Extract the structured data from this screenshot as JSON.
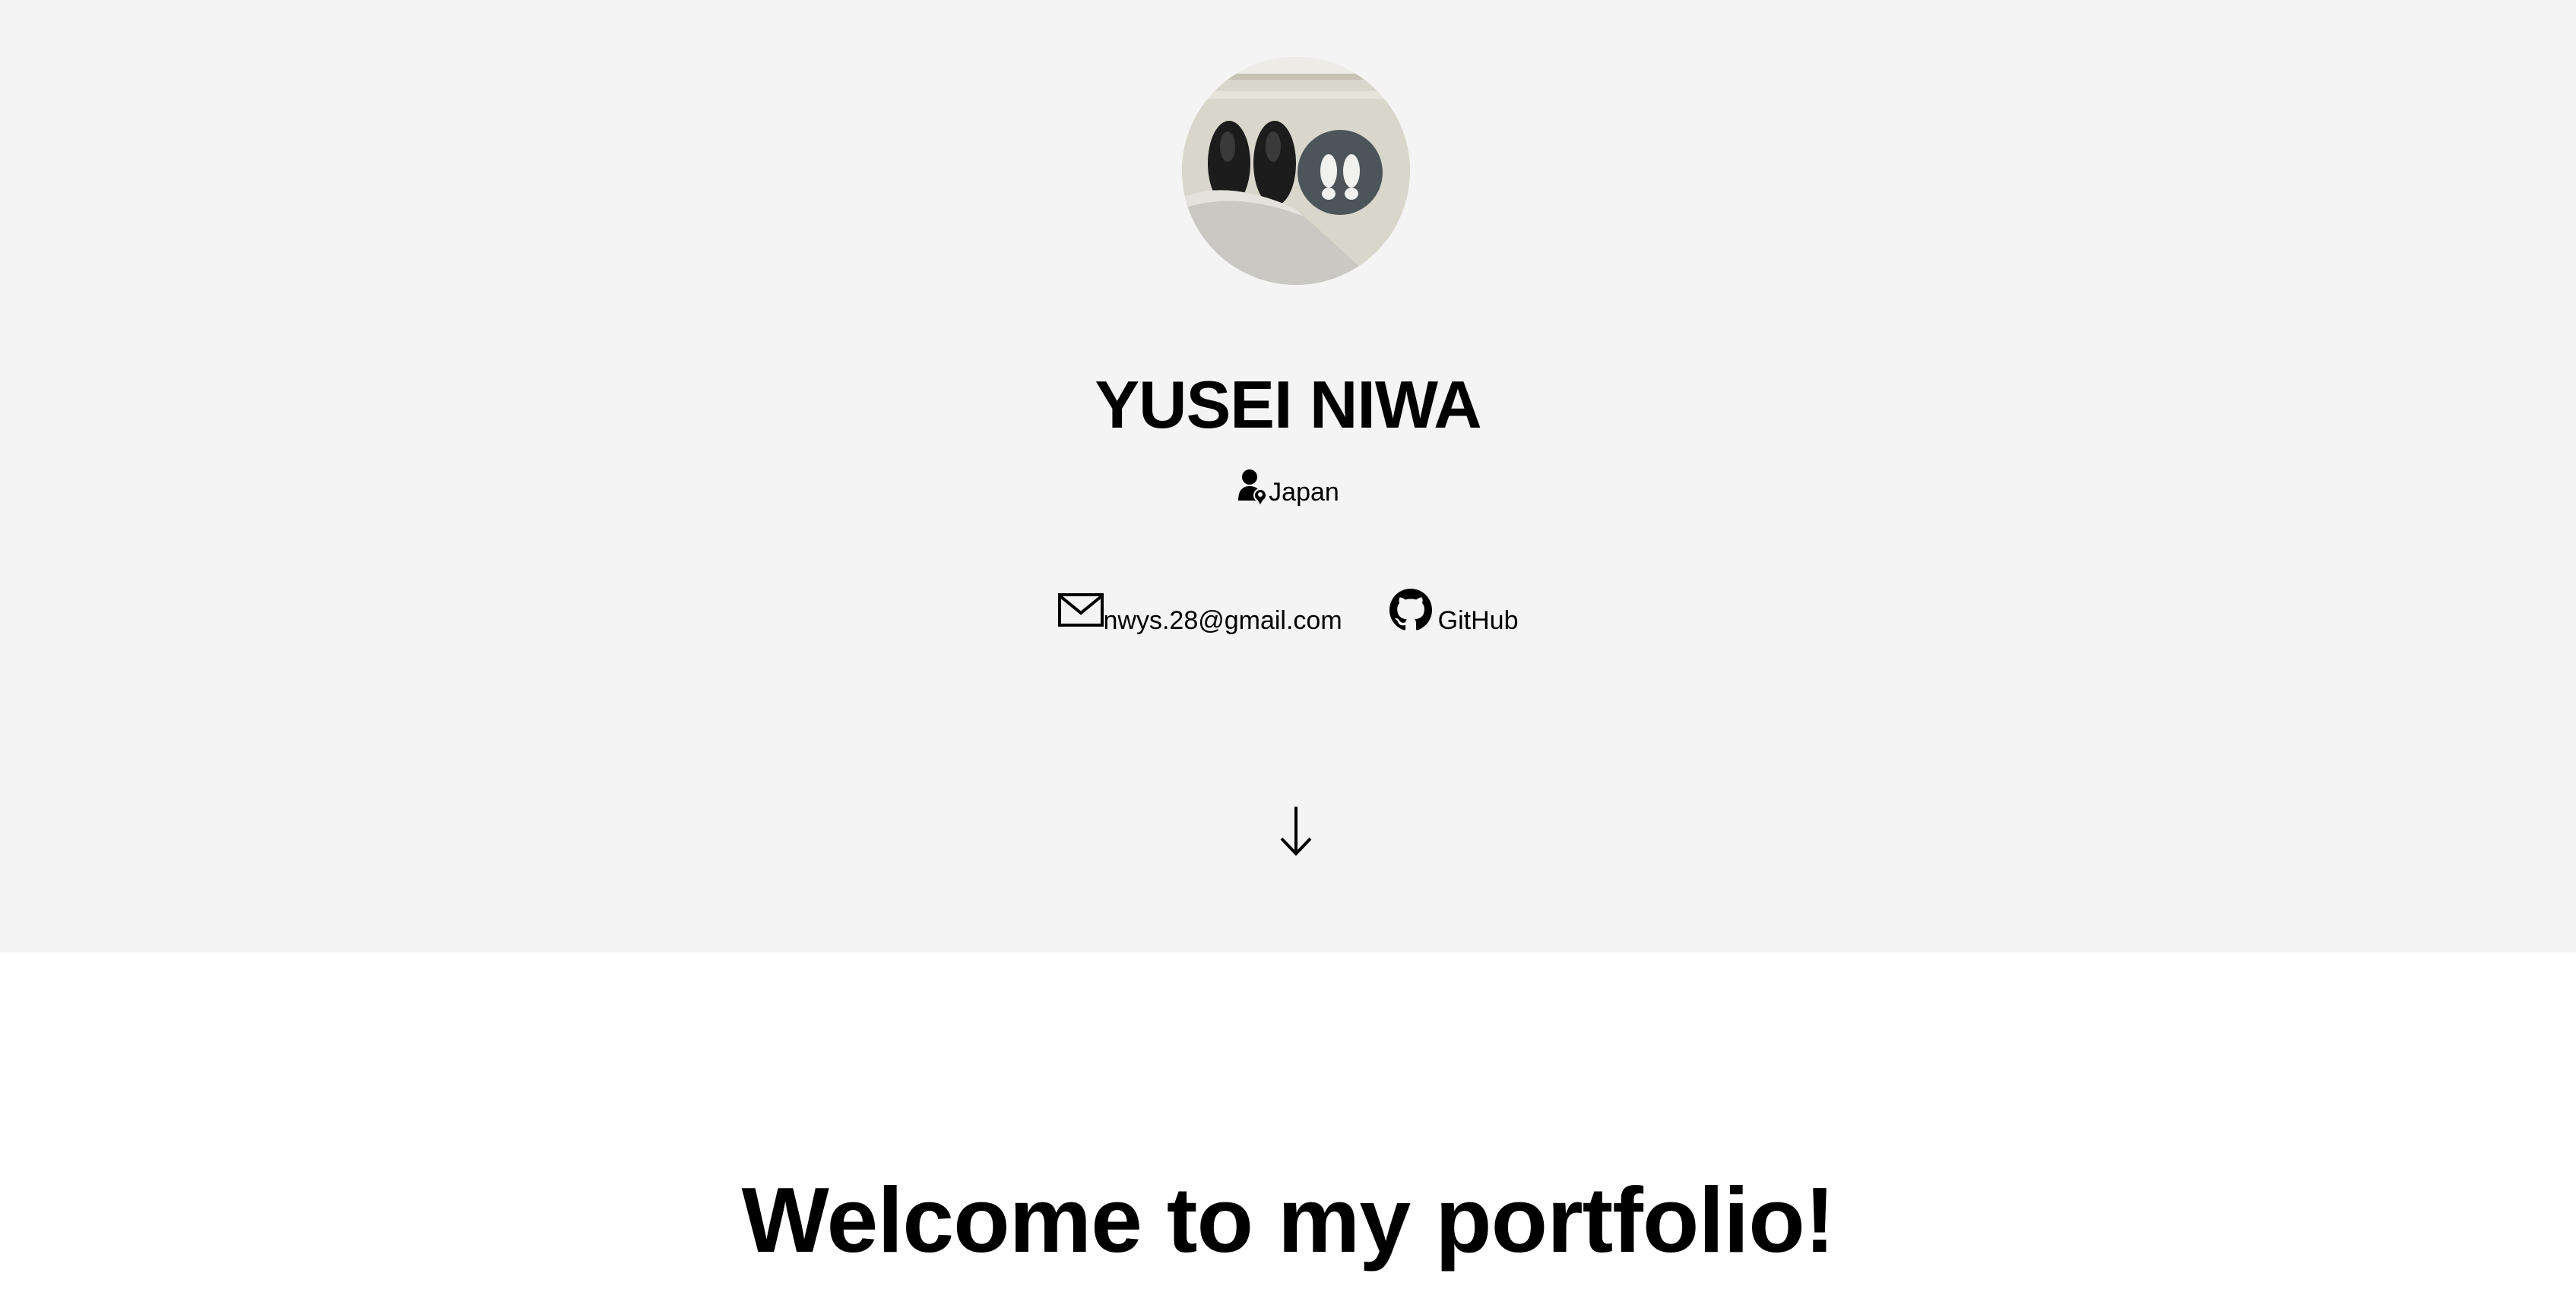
{
  "profile": {
    "name": "YUSEI NIWA",
    "location": "Japan",
    "avatar_icon": "shoes-photo"
  },
  "contacts": {
    "email_label": "nwys.28@gmail.com",
    "email_icon": "envelope-icon",
    "github_label": "GitHub",
    "github_icon": "github-icon"
  },
  "scroll": {
    "icon": "arrow-down-icon"
  },
  "intro": {
    "heading": "Welcome to my portfolio!"
  },
  "colors": {
    "hero_background": "#f4f4f4",
    "page_background": "#ffffff",
    "text": "#000000"
  }
}
